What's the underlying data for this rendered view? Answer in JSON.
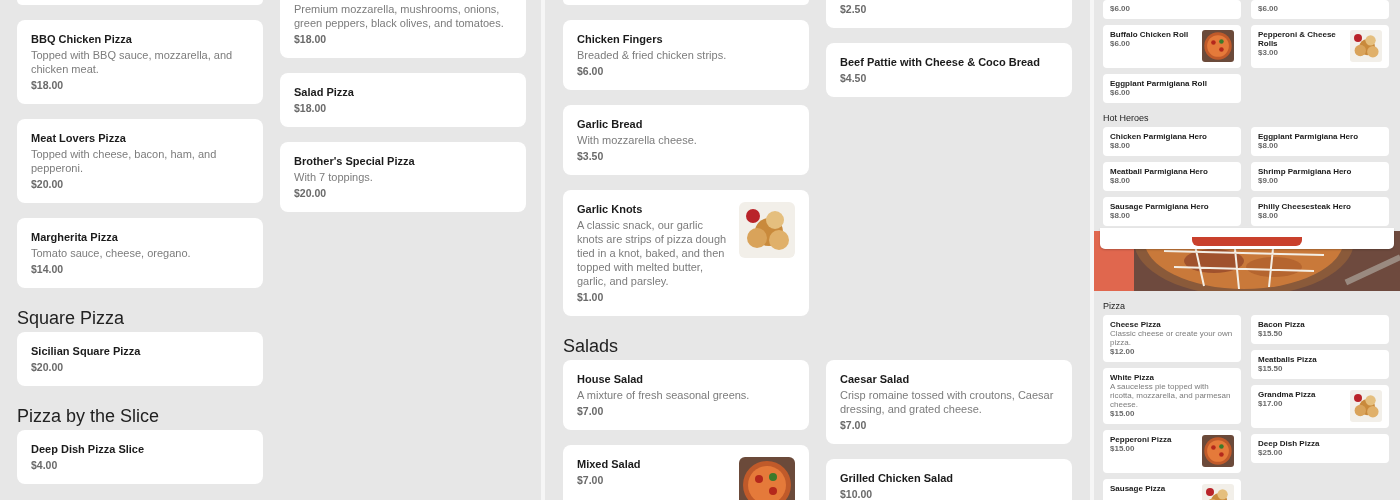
{
  "panels": [
    {
      "sections": [
        {
          "kind": "menu",
          "columns": [
            [
              {
                "kind": "clipped"
              },
              {
                "kind": "full",
                "name": "BBQ Chicken Pizza",
                "description": "Topped with BBQ sauce, mozzarella, and chicken meat.",
                "price": "$18.00"
              },
              {
                "kind": "full",
                "name": "Meat Lovers Pizza",
                "description": "Topped with cheese, bacon, ham, and pepperoni.",
                "price": "$20.00"
              },
              {
                "kind": "full",
                "name": "Margherita Pizza",
                "description": "Tomato sauce, cheese, oregano.",
                "price": "$14.00"
              }
            ],
            [
              {
                "kind": "clipped",
                "description": "Premium mozzarella, mushrooms, onions, green peppers, black olives, and tomatoes.",
                "price": "$18.00"
              },
              {
                "kind": "full",
                "name": "Salad Pizza",
                "price": "$18.00"
              },
              {
                "kind": "full",
                "name": "Brother's Special Pizza",
                "description": "With 7 toppings.",
                "price": "$20.00"
              }
            ]
          ]
        },
        {
          "kind": "menu",
          "heading": "Square Pizza",
          "columns": [
            [
              {
                "kind": "full",
                "name": "Sicilian Square Pizza",
                "price": "$20.00"
              }
            ]
          ]
        },
        {
          "kind": "menu",
          "heading": "Pizza by the Slice",
          "columns": [
            [
              {
                "kind": "full",
                "name": "Deep Dish Pizza Slice",
                "price": "$4.00"
              }
            ]
          ]
        }
      ]
    },
    {
      "sections": [
        {
          "kind": "menu",
          "columns": [
            [
              {
                "kind": "clipped"
              },
              {
                "kind": "full",
                "name": "Chicken Fingers",
                "description": "Breaded & fried chicken strips.",
                "price": "$6.00"
              },
              {
                "kind": "full",
                "name": "Garlic Bread",
                "description": "With mozzarella cheese.",
                "price": "$3.50"
              },
              {
                "kind": "full",
                "name": "Garlic Knots",
                "description": "A classic snack, our garlic knots are strips of pizza dough tied in a knot, baked, and then topped with melted butter, garlic, and parsley.",
                "price": "$1.00"
              }
            ],
            [
              {
                "kind": "clipped",
                "price": "$2.50"
              },
              {
                "kind": "full",
                "name": "Beef Pattie with Cheese & Coco Bread",
                "price": "$4.50"
              }
            ]
          ]
        },
        {
          "kind": "menu",
          "heading": "Salads",
          "columns": [
            [
              {
                "kind": "full",
                "name": "House Salad",
                "description": "A mixture of fresh seasonal greens.",
                "price": "$7.00"
              },
              {
                "kind": "full",
                "name": "Mixed Salad",
                "price": "$7.00"
              }
            ],
            [
              {
                "kind": "full",
                "name": "Caesar Salad",
                "description": "Crisp romaine tossed with croutons, Caesar dressing, and grated cheese.",
                "price": "$7.00"
              },
              {
                "kind": "full",
                "name": "Grilled Chicken Salad",
                "price": "$10.00"
              }
            ]
          ]
        }
      ]
    },
    {
      "sections": [
        {
          "kind": "menu",
          "columns": [
            [
              {
                "kind": "clipped",
                "price": "$6.00"
              },
              {
                "kind": "full",
                "name": "Buffalo Chicken Roll",
                "price": "$6.00"
              },
              {
                "kind": "full",
                "name": "Eggplant Parmigiana Roll",
                "price": "$6.00"
              }
            ],
            [
              {
                "kind": "clipped",
                "price": "$6.00"
              },
              {
                "kind": "full",
                "name": "Pepperoni & Cheese Rolls",
                "price": "$3.00"
              }
            ]
          ]
        },
        {
          "kind": "menu",
          "heading": "Hot Heroes",
          "columns": [
            [
              {
                "kind": "full",
                "name": "Chicken Parmigiana Hero",
                "price": "$8.00"
              },
              {
                "kind": "full",
                "name": "Meatball Parmigiana Hero",
                "price": "$8.00"
              },
              {
                "kind": "full",
                "name": "Sausage Parmigiana Hero",
                "price": "$8.00"
              }
            ],
            [
              {
                "kind": "full",
                "name": "Eggplant Parmigiana Hero",
                "price": "$8.00"
              },
              {
                "kind": "full",
                "name": "Shrimp Parmigiana Hero",
                "price": "$9.00"
              },
              {
                "kind": "full",
                "name": "Philly Cheesesteak Hero",
                "price": "$8.00"
              }
            ]
          ]
        },
        {
          "kind": "banner"
        },
        {
          "kind": "menu",
          "heading": "Pizza",
          "columns": [
            [
              {
                "kind": "full",
                "name": "Cheese Pizza",
                "description": "Classic cheese or create your own pizza.",
                "price": "$12.00"
              },
              {
                "kind": "full",
                "name": "White Pizza",
                "description": "A sauceless pie topped with ricotta, mozzarella, and parmesan cheese.",
                "price": "$15.00"
              },
              {
                "kind": "full",
                "name": "Pepperoni Pizza",
                "price": "$15.00"
              },
              {
                "kind": "full",
                "name": "Sausage Pizza"
              }
            ],
            [
              {
                "kind": "full",
                "name": "Bacon Pizza",
                "price": "$15.50"
              },
              {
                "kind": "full",
                "name": "Meatballs Pizza",
                "price": "$15.50"
              },
              {
                "kind": "full",
                "name": "Grandma Pizza",
                "price": "$17.00"
              },
              {
                "kind": "full",
                "name": "Deep Dish Pizza",
                "price": "$25.00"
              }
            ]
          ]
        }
      ]
    }
  ]
}
